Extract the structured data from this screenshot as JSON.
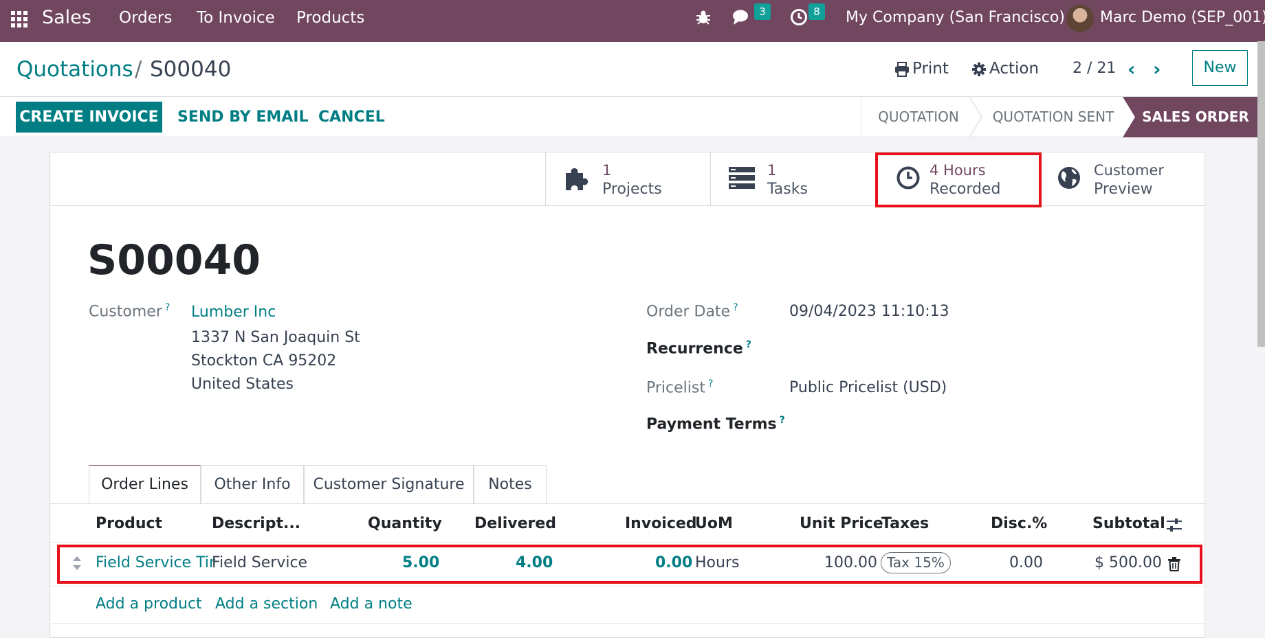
{
  "navbar": {
    "app_name": "Sales",
    "menu": [
      "Orders",
      "To Invoice",
      "Products"
    ],
    "messages_count": "3",
    "activities_count": "8",
    "company": "My Company (San Francisco)",
    "user": "Marc Demo (SEP_001)",
    "bg_color": "#71465f"
  },
  "breadcrumb": {
    "parent": "Quotations",
    "separator": "/",
    "current": "S00040"
  },
  "control": {
    "print_label": "Print",
    "action_label": "Action",
    "pager": "2 / 21",
    "new_label": "New"
  },
  "statusbar": {
    "create_invoice": "CREATE INVOICE",
    "send_email": "SEND BY EMAIL",
    "cancel": "CANCEL",
    "stages": [
      "QUOTATION",
      "QUOTATION SENT",
      "SALES ORDER"
    ],
    "active_stage": "SALES ORDER"
  },
  "smart_buttons": [
    {
      "value": "1",
      "label": "Projects",
      "icon": "puzzle-icon"
    },
    {
      "value": "1",
      "label": "Tasks",
      "icon": "tasks-icon"
    },
    {
      "value": "4 Hours",
      "label": "Recorded",
      "icon": "clock-icon"
    },
    {
      "value": "Customer",
      "label": "Preview",
      "icon": "globe-icon"
    }
  ],
  "record": {
    "name": "S00040",
    "customer_label": "Customer",
    "customer_name": "Lumber Inc",
    "address": [
      "1337 N San Joaquin St",
      "Stockton CA 95202",
      "United States"
    ],
    "order_date_label": "Order Date",
    "order_date": "09/04/2023 11:10:13",
    "recurrence_label": "Recurrence",
    "pricelist_label": "Pricelist",
    "pricelist": "Public Pricelist (USD)",
    "payment_terms_label": "Payment Terms",
    "help_mark": "?"
  },
  "tabs": [
    "Order Lines",
    "Other Info",
    "Customer Signature",
    "Notes"
  ],
  "table": {
    "headers": [
      "Product",
      "Descript...",
      "Quantity",
      "Delivered",
      "Invoiced",
      "UoM",
      "Unit Price",
      "Taxes",
      "Disc.%",
      "Subtotal"
    ],
    "rows": [
      {
        "product": "Field Service Tir",
        "description": "Field Service",
        "quantity": "5.00",
        "delivered": "4.00",
        "invoiced": "0.00",
        "uom": "Hours",
        "unit_price": "100.00",
        "taxes": "Tax 15%",
        "discount": "0.00",
        "subtotal": "$ 500.00"
      }
    ],
    "add_links": [
      "Add a product",
      "Add a section",
      "Add a note"
    ]
  },
  "highlight_color": "#e8101b"
}
